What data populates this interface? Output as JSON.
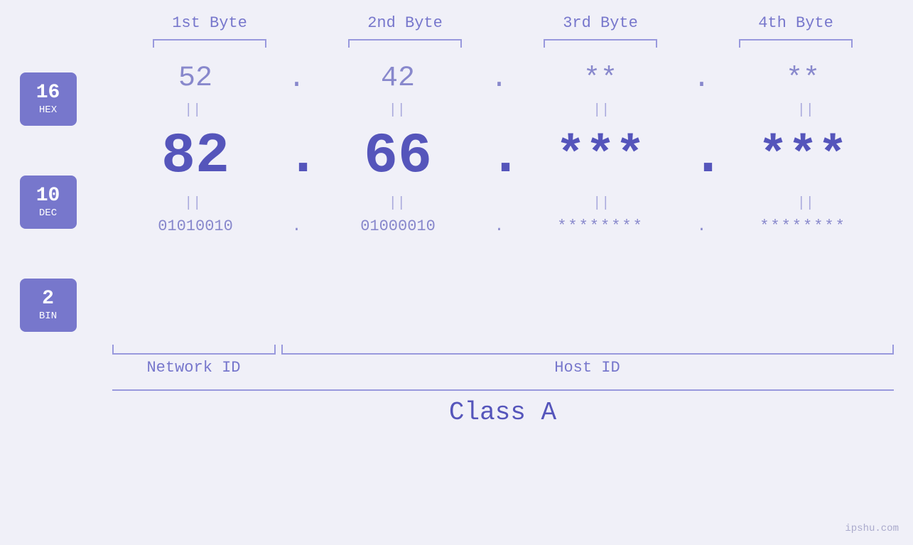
{
  "headers": {
    "byte1": "1st Byte",
    "byte2": "2nd Byte",
    "byte3": "3rd Byte",
    "byte4": "4th Byte"
  },
  "badges": {
    "hex": {
      "num": "16",
      "base": "HEX"
    },
    "dec": {
      "num": "10",
      "base": "DEC"
    },
    "bin": {
      "num": "2",
      "base": "BIN"
    }
  },
  "hex_row": {
    "b1": "52",
    "b2": "42",
    "b3": "**",
    "b4": "**",
    "sep": "."
  },
  "dec_row": {
    "b1": "82",
    "b2": "66",
    "b3": "***",
    "b4": "***",
    "sep": "."
  },
  "bin_row": {
    "b1": "01010010",
    "b2": "01000010",
    "b3": "********",
    "b4": "********",
    "sep": "."
  },
  "labels": {
    "network_id": "Network ID",
    "host_id": "Host ID",
    "class": "Class A"
  },
  "watermark": "ipshu.com",
  "equals_sign": "||"
}
